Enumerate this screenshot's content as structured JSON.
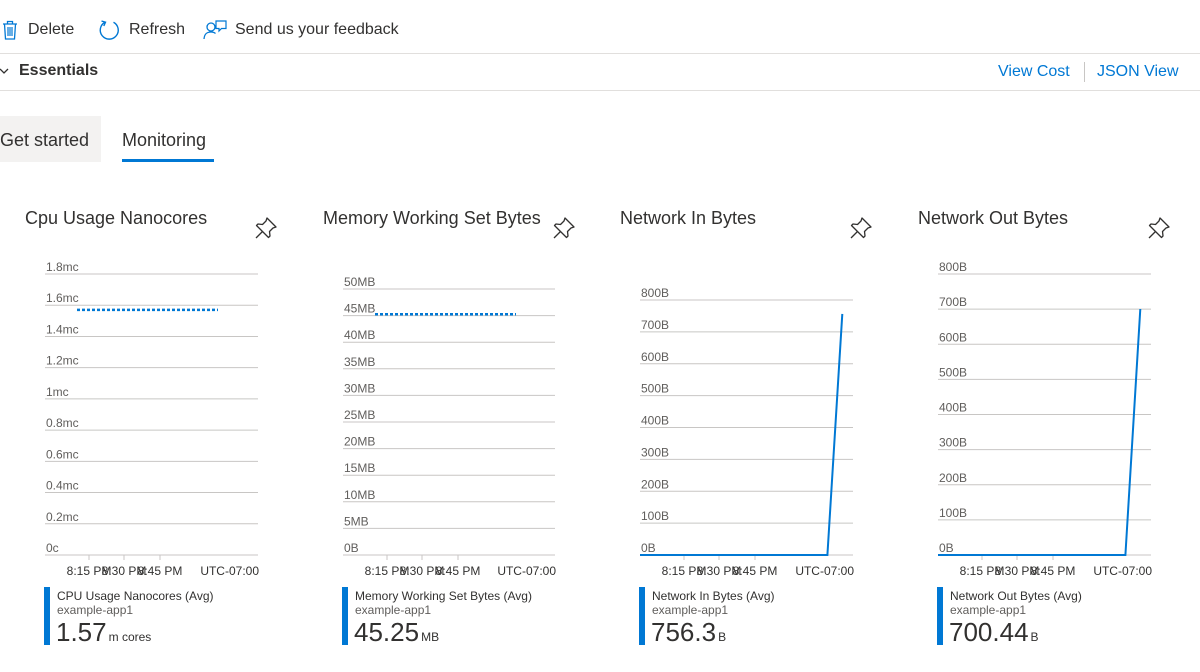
{
  "toolbar": {
    "delete_label": "Delete",
    "refresh_label": "Refresh",
    "feedback_label": "Send us your feedback"
  },
  "essentials": {
    "label": "Essentials",
    "view_cost": "View Cost",
    "json_view": "JSON View"
  },
  "tabs": [
    {
      "label": "Get started",
      "selected": false
    },
    {
      "label": "Monitoring",
      "selected": true
    }
  ],
  "colors": {
    "accent": "#0078d4",
    "grid": "#c8c6c4",
    "text": "#323130"
  },
  "charts": [
    {
      "title": "Cpu Usage Nanocores",
      "legend_name": "CPU Usage Nanocores (Avg)",
      "legend_sub": "example-app1",
      "value": "1.57",
      "unit": "m cores"
    },
    {
      "title": "Memory Working Set Bytes",
      "legend_name": "Memory Working Set Bytes (Avg)",
      "legend_sub": "example-app1",
      "value": "45.25",
      "unit": "MB"
    },
    {
      "title": "Network In Bytes",
      "legend_name": "Network In Bytes (Avg)",
      "legend_sub": "example-app1",
      "value": "756.3",
      "unit": "B"
    },
    {
      "title": "Network Out Bytes",
      "legend_name": "Network Out Bytes (Avg)",
      "legend_sub": "example-app1",
      "value": "700.44",
      "unit": "B"
    }
  ],
  "chart_data": [
    {
      "type": "line",
      "title": "Cpu Usage Nanocores",
      "y_ticks": [
        "0c",
        "0.2mc",
        "0.4mc",
        "0.6mc",
        "0.8mc",
        "1mc",
        "1.2mc",
        "1.4mc",
        "1.6mc",
        "1.8mc"
      ],
      "ylim": [
        0,
        1.8
      ],
      "x_ticks": [
        "8:15 PM",
        "8:30 PM",
        "8:45 PM"
      ],
      "timezone": "UTC-07:00",
      "line_style": "dashed",
      "series": [
        {
          "name": "CPU Usage Nanocores (Avg)",
          "x": [
            0,
            1
          ],
          "y": [
            1.57,
            1.57
          ]
        }
      ]
    },
    {
      "type": "line",
      "title": "Memory Working Set Bytes",
      "y_ticks": [
        "0B",
        "5MB",
        "10MB",
        "15MB",
        "20MB",
        "25MB",
        "30MB",
        "35MB",
        "40MB",
        "45MB",
        "50MB"
      ],
      "ylim": [
        0,
        50
      ],
      "x_ticks": [
        "8:15 PM",
        "8:30 PM",
        "8:45 PM"
      ],
      "timezone": "UTC-07:00",
      "line_style": "dashed",
      "series": [
        {
          "name": "Memory Working Set Bytes (Avg)",
          "x": [
            0,
            1
          ],
          "y": [
            45.25,
            45.25
          ]
        }
      ]
    },
    {
      "type": "line",
      "title": "Network In Bytes",
      "y_ticks": [
        "0B",
        "100B",
        "200B",
        "300B",
        "400B",
        "500B",
        "600B",
        "700B",
        "800B"
      ],
      "ylim": [
        0,
        800
      ],
      "x_ticks": [
        "8:15 PM",
        "8:30 PM",
        "8:45 PM"
      ],
      "timezone": "UTC-07:00",
      "line_style": "solid",
      "series": [
        {
          "name": "Network In Bytes (Avg)",
          "x": [
            0,
            0.88,
            0.95
          ],
          "y": [
            0,
            0,
            756.3
          ]
        }
      ]
    },
    {
      "type": "line",
      "title": "Network Out Bytes",
      "y_ticks": [
        "0B",
        "100B",
        "200B",
        "300B",
        "400B",
        "500B",
        "600B",
        "700B",
        "800B"
      ],
      "ylim": [
        0,
        800
      ],
      "x_ticks": [
        "8:15 PM",
        "8:30 PM",
        "8:45 PM"
      ],
      "timezone": "UTC-07:00",
      "line_style": "solid",
      "series": [
        {
          "name": "Network Out Bytes (Avg)",
          "x": [
            0,
            0.88,
            0.95
          ],
          "y": [
            0,
            0,
            700.44
          ]
        }
      ]
    }
  ]
}
